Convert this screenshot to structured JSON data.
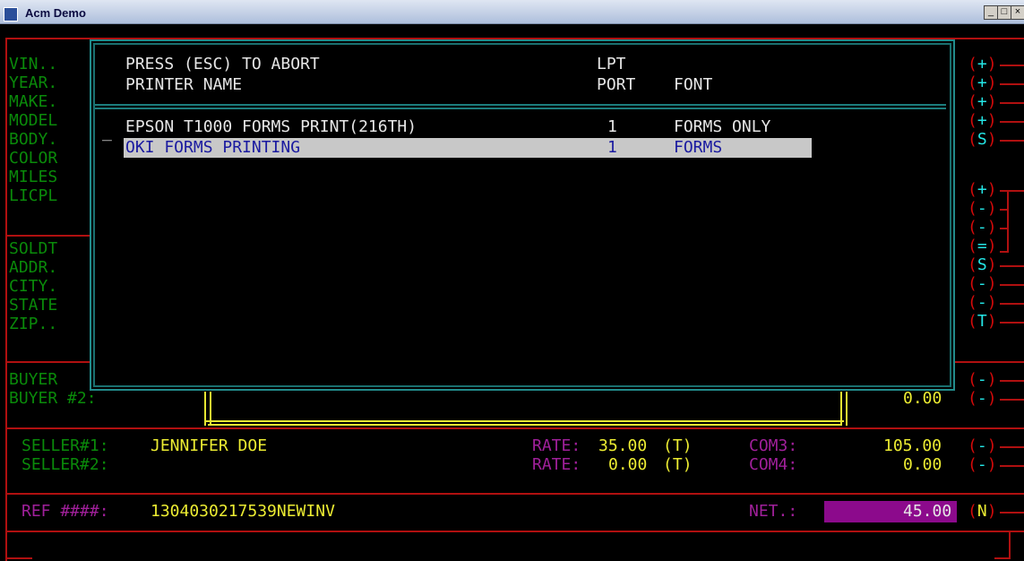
{
  "window": {
    "title": "Acm Demo",
    "buttons": [
      "_",
      "□",
      "×"
    ]
  },
  "left_labels": [
    "VIN..",
    "YEAR.",
    "MAKE.",
    "MODEL",
    "BODY.",
    "COLOR",
    "MILES",
    "LICPL",
    "SOLDT",
    "ADDR.",
    "CITY.",
    "STATE",
    "ZIP..",
    "BUYER"
  ],
  "buyer2": {
    "label": "BUYER #2:",
    "value": "0.00"
  },
  "right_markers": [
    "(+)",
    "(+)",
    "(+)",
    "(+)",
    "(S)",
    "(+)",
    "(-)",
    "(-)",
    "(=)",
    "(S)",
    "(-)",
    "(-)",
    "(T)",
    "(-)",
    "(-)",
    "(-)",
    "(-)",
    "(N)"
  ],
  "popup": {
    "header_line1_left": "PRESS (ESC) TO ABORT",
    "header_line1_port": "LPT",
    "header_line2_left": "PRINTER NAME",
    "header_line2_port": "PORT",
    "header_line2_font": "FONT",
    "cursor": "_",
    "printers": [
      {
        "name": "EPSON T1000 FORMS PRINT(216TH)",
        "port": "1",
        "font": "FORMS ONLY"
      },
      {
        "name": "OKI FORMS PRINTING",
        "port": "1",
        "font": "FORMS"
      }
    ]
  },
  "sellers": [
    {
      "label": "SELLER#1:",
      "name": "JENNIFER DOE",
      "rate_label": "RATE:",
      "rate": "35.00",
      "rate_flag": "(T)",
      "com_label": "COM3:",
      "com_value": "105.00"
    },
    {
      "label": "SELLER#2:",
      "name": "",
      "rate_label": "RATE:",
      "rate": "0.00",
      "rate_flag": "(T)",
      "com_label": "COM4:",
      "com_value": "0.00"
    }
  ],
  "ref": {
    "label": "REF ####:",
    "value": "1304030217539NEWINV"
  },
  "net": {
    "label": "NET.:",
    "value": "45.00"
  }
}
